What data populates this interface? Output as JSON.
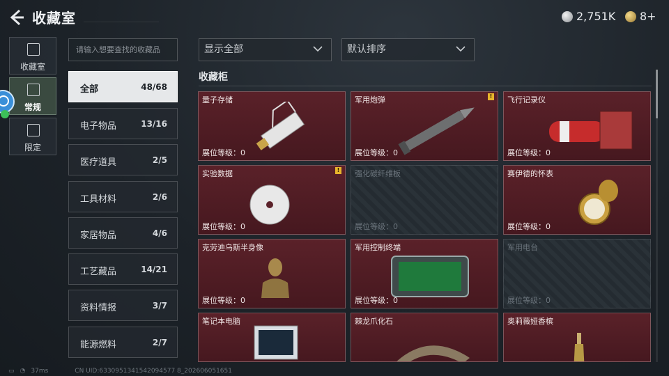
{
  "header": {
    "title": "收藏室"
  },
  "currency": [
    {
      "icon": "silver-coin-icon",
      "value": "2,751K"
    },
    {
      "icon": "gold-coin-icon",
      "value": "8+"
    }
  ],
  "tabs": [
    {
      "label": "收藏室",
      "icon": "collection-room-icon"
    },
    {
      "label": "常规",
      "icon": "regular-icon",
      "active": true
    },
    {
      "label": "限定",
      "icon": "limited-icon"
    }
  ],
  "search": {
    "placeholder": "请输入想要查找的收藏品"
  },
  "categories": [
    {
      "name": "全部",
      "count": "48/68",
      "active": true
    },
    {
      "name": "电子物品",
      "count": "13/16"
    },
    {
      "name": "医疗道具",
      "count": "2/5"
    },
    {
      "name": "工具材料",
      "count": "2/6"
    },
    {
      "name": "家居物品",
      "count": "4/6"
    },
    {
      "name": "工艺藏品",
      "count": "14/21"
    },
    {
      "name": "资料情报",
      "count": "3/7"
    },
    {
      "name": "能源燃料",
      "count": "2/7"
    }
  ],
  "filter": {
    "display": "显示全部",
    "sort": "默认排序"
  },
  "section_title": "收藏柜",
  "items": [
    {
      "name": "量子存储",
      "level": "展位等级：0",
      "owned": true,
      "badge": false
    },
    {
      "name": "军用炮弹",
      "level": "展位等级：0",
      "owned": true,
      "badge": true
    },
    {
      "name": "飞行记录仪",
      "level": "展位等级：0",
      "owned": true,
      "badge": false
    },
    {
      "name": "实验数据",
      "level": "展位等级：0",
      "owned": true,
      "badge": true
    },
    {
      "name": "强化碳纤维板",
      "level": "展位等级：0",
      "owned": false,
      "badge": false
    },
    {
      "name": "赛伊德的怀表",
      "level": "展位等级：0",
      "owned": true,
      "badge": false
    },
    {
      "name": "克劳迪乌斯半身像",
      "level": "展位等级：0",
      "owned": true,
      "badge": false
    },
    {
      "name": "军用控制终端",
      "level": "展位等级：0",
      "owned": true,
      "badge": false
    },
    {
      "name": "军用电台",
      "level": "展位等级：0",
      "owned": false,
      "badge": false
    },
    {
      "name": "笔记本电脑",
      "level": "",
      "owned": true,
      "badge": false
    },
    {
      "name": "棘龙爪化石",
      "level": "",
      "owned": true,
      "badge": false
    },
    {
      "name": "奥莉薇娅香槟",
      "level": "",
      "owned": true,
      "badge": false
    }
  ],
  "badge_text": "!",
  "footer": {
    "ping": "37ms",
    "uid": "CN UID:6330951341542094577 8_202606051651"
  }
}
